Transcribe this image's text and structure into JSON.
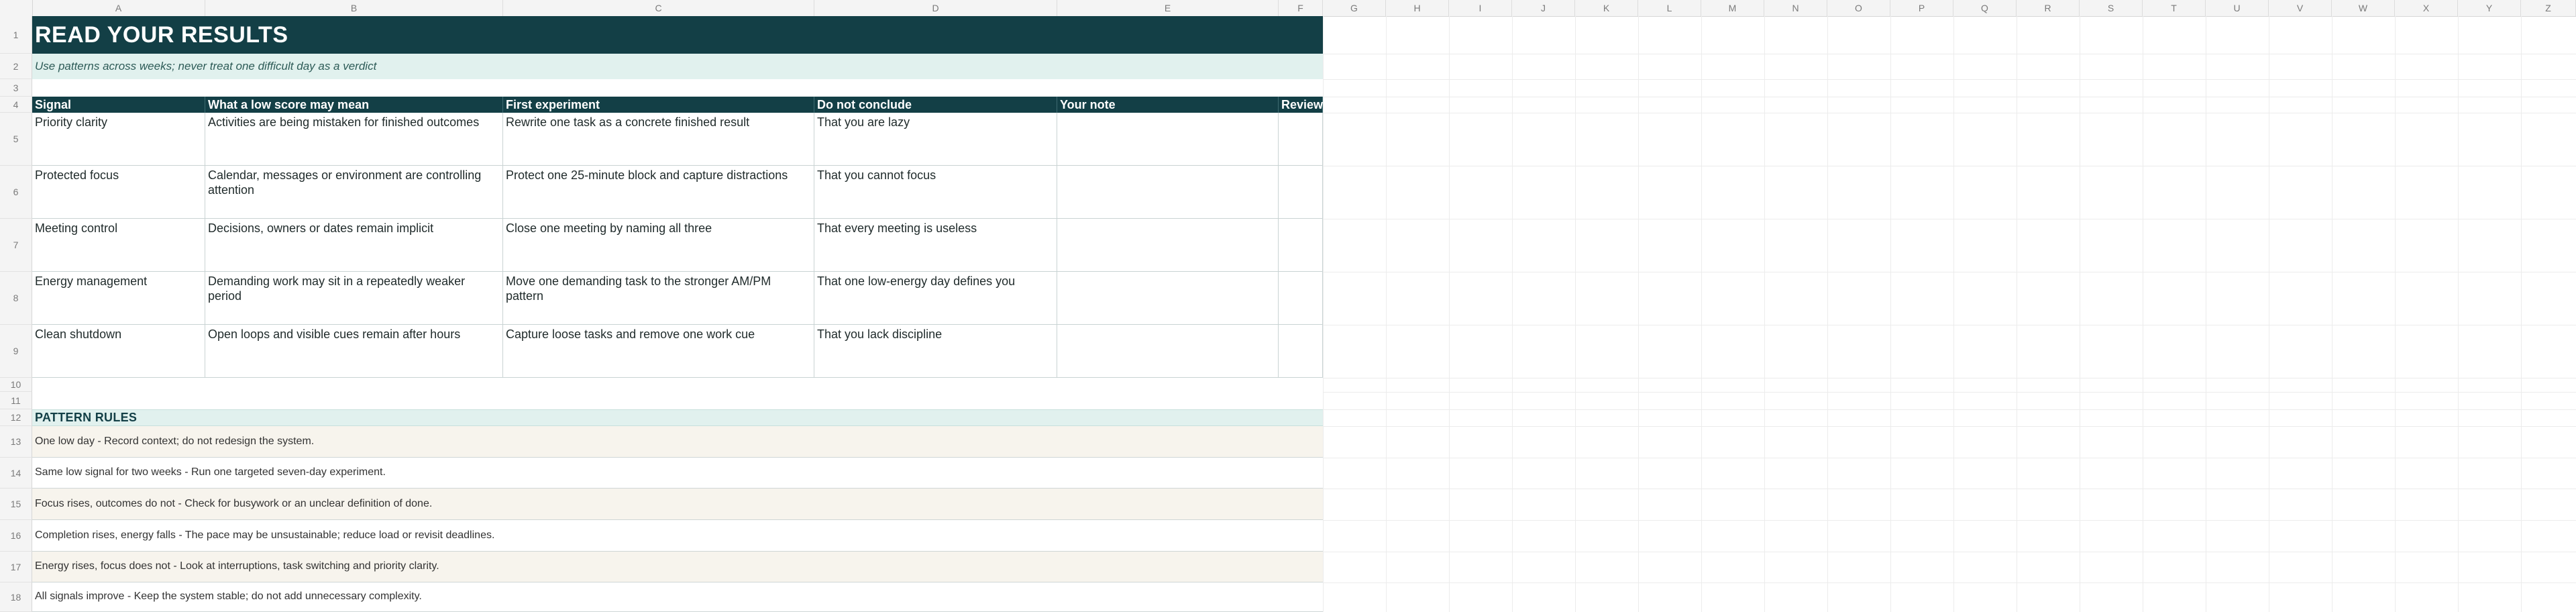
{
  "columns": [
    "A",
    "B",
    "C",
    "D",
    "E",
    "F",
    "G",
    "H",
    "I",
    "J",
    "K",
    "L",
    "M",
    "N",
    "O",
    "P",
    "Q",
    "R",
    "S",
    "T",
    "U",
    "V",
    "W",
    "X",
    "Y",
    "Z"
  ],
  "rows": [
    "1",
    "2",
    "3",
    "4",
    "5",
    "6",
    "7",
    "8",
    "9",
    "10",
    "11",
    "12",
    "13",
    "14",
    "15",
    "16",
    "17",
    "18"
  ],
  "title": "READ YOUR RESULTS",
  "subtitle": "Use patterns across weeks; never treat one difficult day as a verdict",
  "table": {
    "headers": [
      "Signal",
      "What a low score may mean",
      "First experiment",
      "Do not conclude",
      "Your note",
      "Review date"
    ],
    "rows": [
      [
        "Priority clarity",
        "Activities are being mistaken for finished outcomes",
        "Rewrite one task as a concrete finished result",
        "That you are lazy",
        "",
        ""
      ],
      [
        "Protected focus",
        "Calendar, messages or environment are controlling attention",
        "Protect one 25-minute block and capture distractions",
        "That you cannot focus",
        "",
        ""
      ],
      [
        "Meeting control",
        "Decisions, owners or dates remain implicit",
        "Close one meeting by naming all three",
        "That every meeting is useless",
        "",
        ""
      ],
      [
        "Energy management",
        "Demanding work may sit in a repeatedly weaker period",
        "Move one demanding task to the stronger AM/PM pattern",
        "That one low-energy day defines you",
        "",
        ""
      ],
      [
        "Clean shutdown",
        "Open loops and visible cues remain after hours",
        "Capture loose tasks and remove one work cue",
        "That you lack discipline",
        "",
        ""
      ]
    ]
  },
  "section_title": "PATTERN RULES",
  "rules": [
    "One low day - Record context; do not redesign the system.",
    "Same low signal for two weeks - Run one targeted seven-day experiment.",
    "Focus rises, outcomes do not - Check for busywork or an unclear definition of done.",
    "Completion rises, energy falls - The pace may be unsustainable; reduce load or revisit deadlines.",
    "Energy rises, focus does not - Look at interruptions, task switching and priority clarity.",
    "All signals improve - Keep the system stable; do not add unnecessary complexity."
  ],
  "colors": {
    "header_dark": "#133f46",
    "band_light": "#e1f1ee",
    "rule_alt": "#f7f4ed"
  }
}
